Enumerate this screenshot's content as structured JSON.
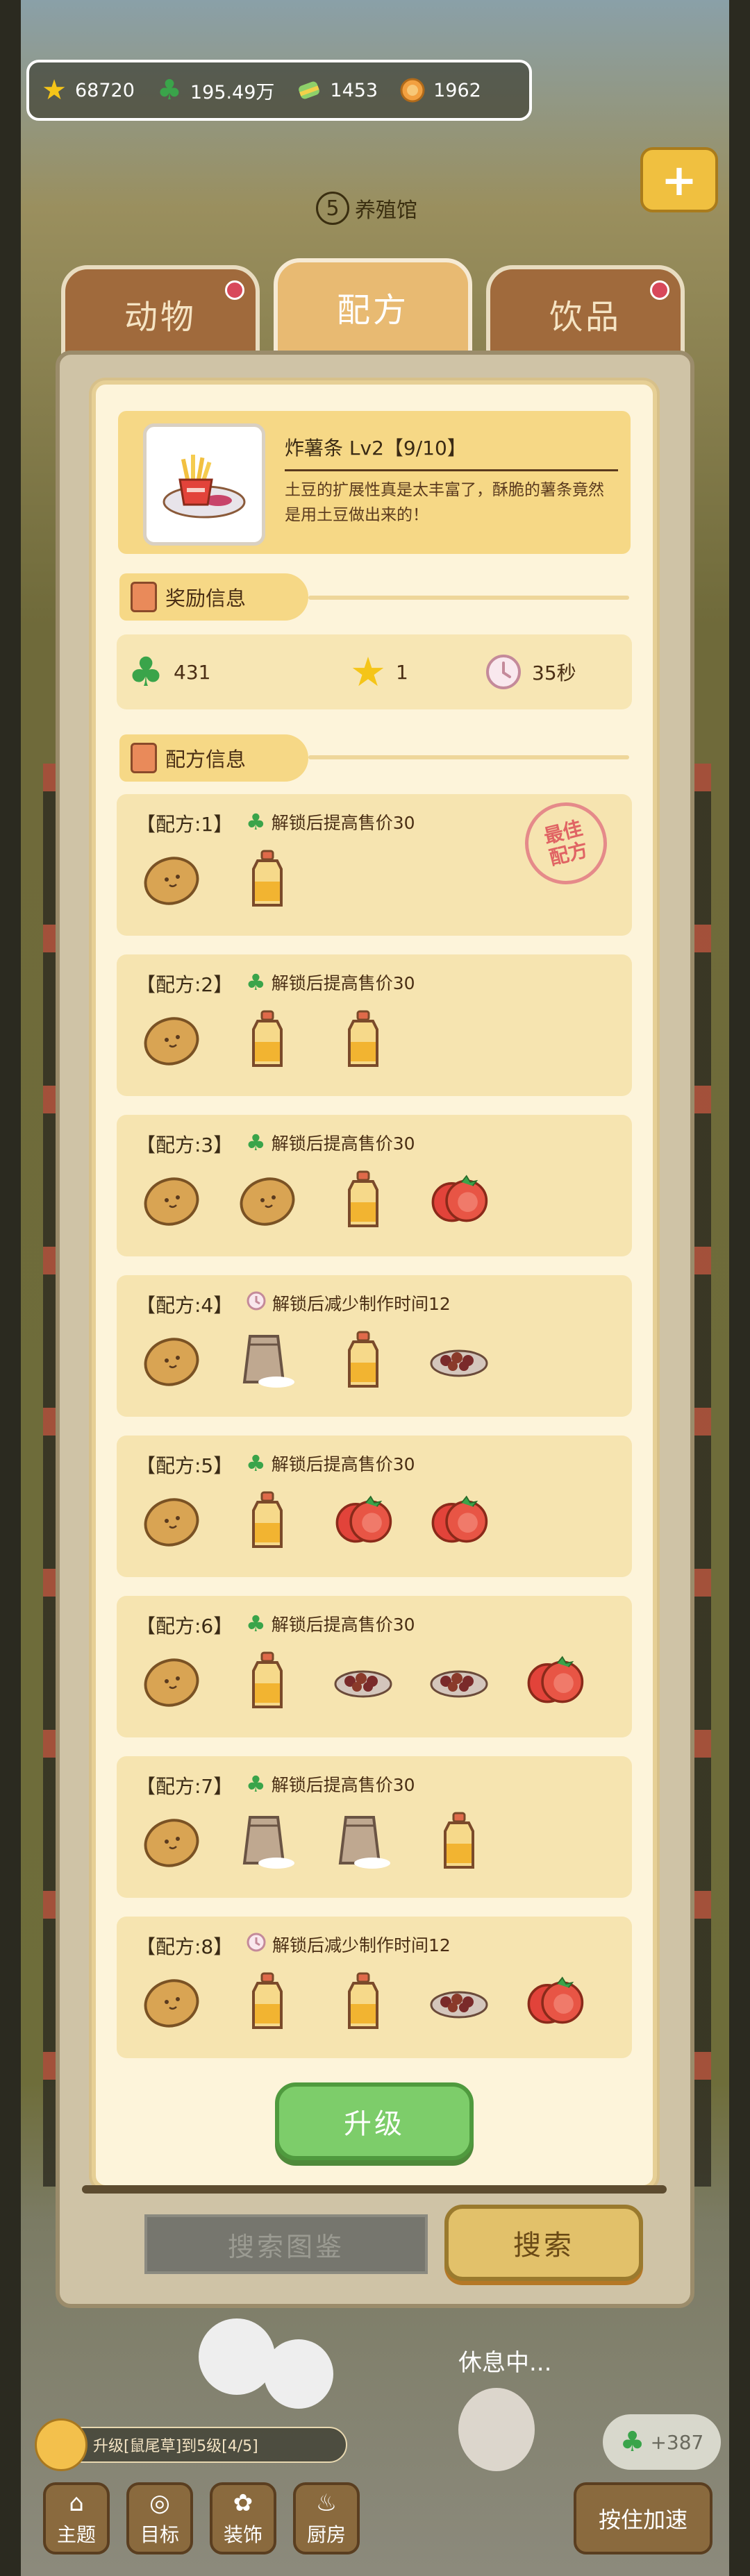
{
  "currencies": [
    {
      "icon": "star-icon",
      "value": "68720"
    },
    {
      "icon": "clover-icon",
      "value": "195.49万"
    },
    {
      "icon": "candy-icon",
      "value": "1453"
    },
    {
      "icon": "coin-icon",
      "value": "1962"
    }
  ],
  "location": {
    "number": "5",
    "name": "养殖馆"
  },
  "tabs": [
    {
      "label": "动物",
      "active": false,
      "has_dot": true
    },
    {
      "label": "配方",
      "active": true,
      "has_dot": false
    },
    {
      "label": "饮品",
      "active": false,
      "has_dot": true
    }
  ],
  "dish": {
    "title": "炸薯条 Lv2【9/10】",
    "description": "土豆的扩展性真是太丰富了，酥脆的薯条竟然是用土豆做出来的！"
  },
  "sections": {
    "reward": "奖励信息",
    "recipe": "配方信息"
  },
  "rewards": [
    {
      "icon": "clover-icon",
      "value": "431"
    },
    {
      "icon": "star-icon",
      "value": "1"
    },
    {
      "icon": "clock-icon",
      "value": "35秒"
    }
  ],
  "best_stamp": "最佳\n配方",
  "recipes": [
    {
      "title": "【配方:1】",
      "bonus_icon": "clover-icon",
      "bonus": "解锁后提高售价30",
      "best": true,
      "ingredients": [
        "potato",
        "oil"
      ]
    },
    {
      "title": "【配方:2】",
      "bonus_icon": "clover-icon",
      "bonus": "解锁后提高售价30",
      "best": false,
      "ingredients": [
        "potato",
        "oil",
        "oil"
      ]
    },
    {
      "title": "【配方:3】",
      "bonus_icon": "clover-icon",
      "bonus": "解锁后提高售价30",
      "best": false,
      "ingredients": [
        "potato",
        "potato",
        "oil",
        "tomato"
      ]
    },
    {
      "title": "【配方:4】",
      "bonus_icon": "clock-icon",
      "bonus": "解锁后减少制作时间12",
      "best": false,
      "ingredients": [
        "potato",
        "flour",
        "oil",
        "meat"
      ]
    },
    {
      "title": "【配方:5】",
      "bonus_icon": "clover-icon",
      "bonus": "解锁后提高售价30",
      "best": false,
      "ingredients": [
        "potato",
        "oil",
        "tomato",
        "tomato"
      ]
    },
    {
      "title": "【配方:6】",
      "bonus_icon": "clover-icon",
      "bonus": "解锁后提高售价30",
      "best": false,
      "ingredients": [
        "potato",
        "oil",
        "meat",
        "meat",
        "tomato"
      ]
    },
    {
      "title": "【配方:7】",
      "bonus_icon": "clover-icon",
      "bonus": "解锁后提高售价30",
      "best": false,
      "ingredients": [
        "potato",
        "flour",
        "flour",
        "oil"
      ]
    },
    {
      "title": "【配方:8】",
      "bonus_icon": "clock-icon",
      "bonus": "解锁后减少制作时间12",
      "best": false,
      "ingredients": [
        "potato",
        "oil",
        "oil",
        "meat",
        "tomato"
      ]
    }
  ],
  "buttons": {
    "upgrade": "升级",
    "search_placeholder": "搜索图鉴",
    "search": "搜索"
  },
  "bottom": {
    "resting": "休息中...",
    "task": "升级[鼠尾草]到5级[4/5]",
    "clover_bonus": "+387",
    "nav": [
      {
        "label": "主题",
        "icon": "theme-icon"
      },
      {
        "label": "目标",
        "icon": "target-icon"
      },
      {
        "label": "装饰",
        "icon": "decor-icon"
      },
      {
        "label": "厨房",
        "icon": "kitchen-icon"
      }
    ],
    "speed_button": "按住加速"
  }
}
